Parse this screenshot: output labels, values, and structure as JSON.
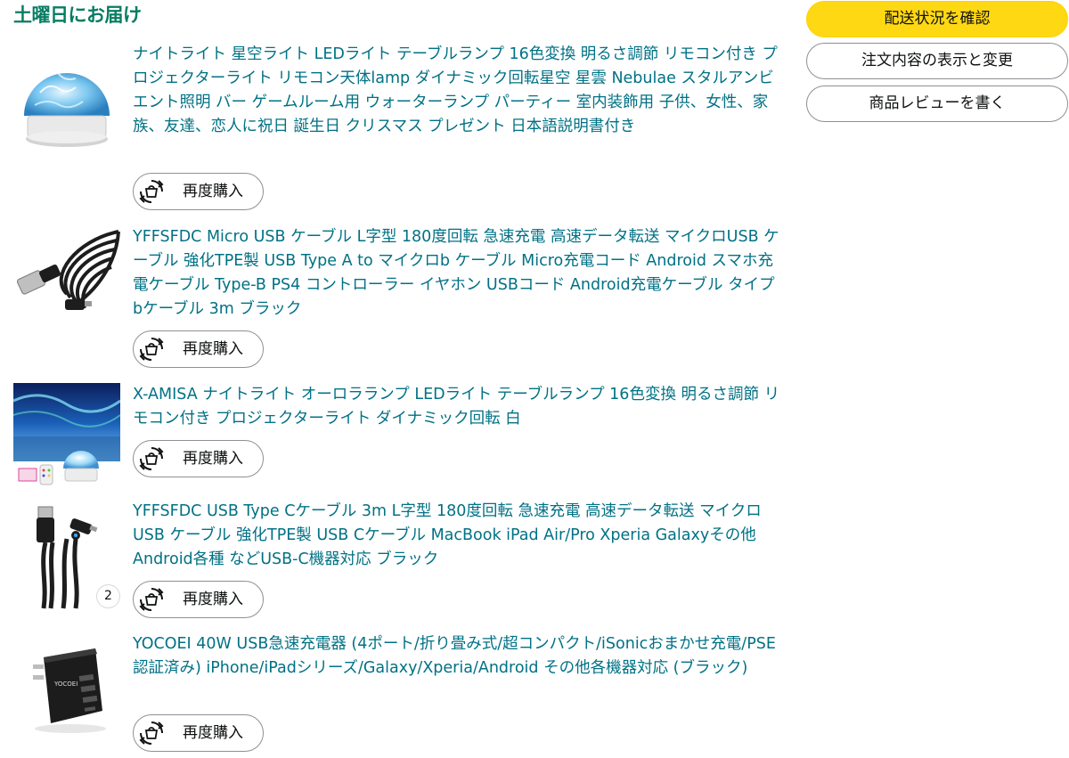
{
  "delivery": {
    "title": "土曜日にお届け"
  },
  "actions": {
    "track": "配送状況を確認",
    "view_edit": "注文内容の表示と変更",
    "review": "商品レビューを書く"
  },
  "items": [
    {
      "title": "ナイトライト 星空ライト LEDライト テーブルランプ 16色変換 明るさ調節 リモコン付き プロジェクターライト リモコン天体lamp ダイナミック回転星空 星雲 Nebulae スタルアンビエント照明 バー ゲームルーム用 ウォーターランプ パーティー 室内装飾用 子供、女性、家族、友達、恋人に祝日 誕生日 クリスマス プレゼント 日本語説明書付き",
      "rebuy": "再度購入"
    },
    {
      "title": "YFFSFDC Micro USB ケーブル L字型 180度回転 急速充電 高速データ転送 マイクロUSB ケーブル 強化TPE製 USB Type A to マイクロb ケーブル Micro充電コード Android スマホ充電ケーブル Type-B PS4 コントローラー イヤホン USBコード Android充電ケーブル タイプbケーブル 3m ブラック",
      "rebuy": "再度購入"
    },
    {
      "title": "X-AMISA ナイトライト オーロラランプ LEDライト テーブルランプ 16色変換 明るさ調節 リモコン付き プロジェクターライト ダイナミック回転 白",
      "rebuy": "再度購入"
    },
    {
      "title": "YFFSFDC USB Type Cケーブル 3m L字型 180度回転 急速充電 高速データ転送 マイクロ USB ケーブル 強化TPE製 USB Cケーブル MacBook iPad Air/Pro Xperia Galaxyその他Android各種 などUSB-C機器対応 ブラック",
      "rebuy": "再度購入",
      "quantity": "2"
    },
    {
      "title": "YOCOEI 40W USB急速充電器 (4ポート/折り畳み式/超コンパクト/iSonicおまかせ充電/PSE認証済み) iPhone/iPadシリーズ/Galaxy/Xperia/Android その他各機器対応 (ブラック)",
      "rebuy": "再度購入",
      "brand_print": "YOCOEI"
    }
  ],
  "colors": {
    "link": "#007185",
    "delivery_green": "#067d62",
    "primary_button": "#ffd814",
    "button_border": "#8d9096"
  },
  "icons": [
    "rebuy-icon",
    "quantity-badge"
  ]
}
